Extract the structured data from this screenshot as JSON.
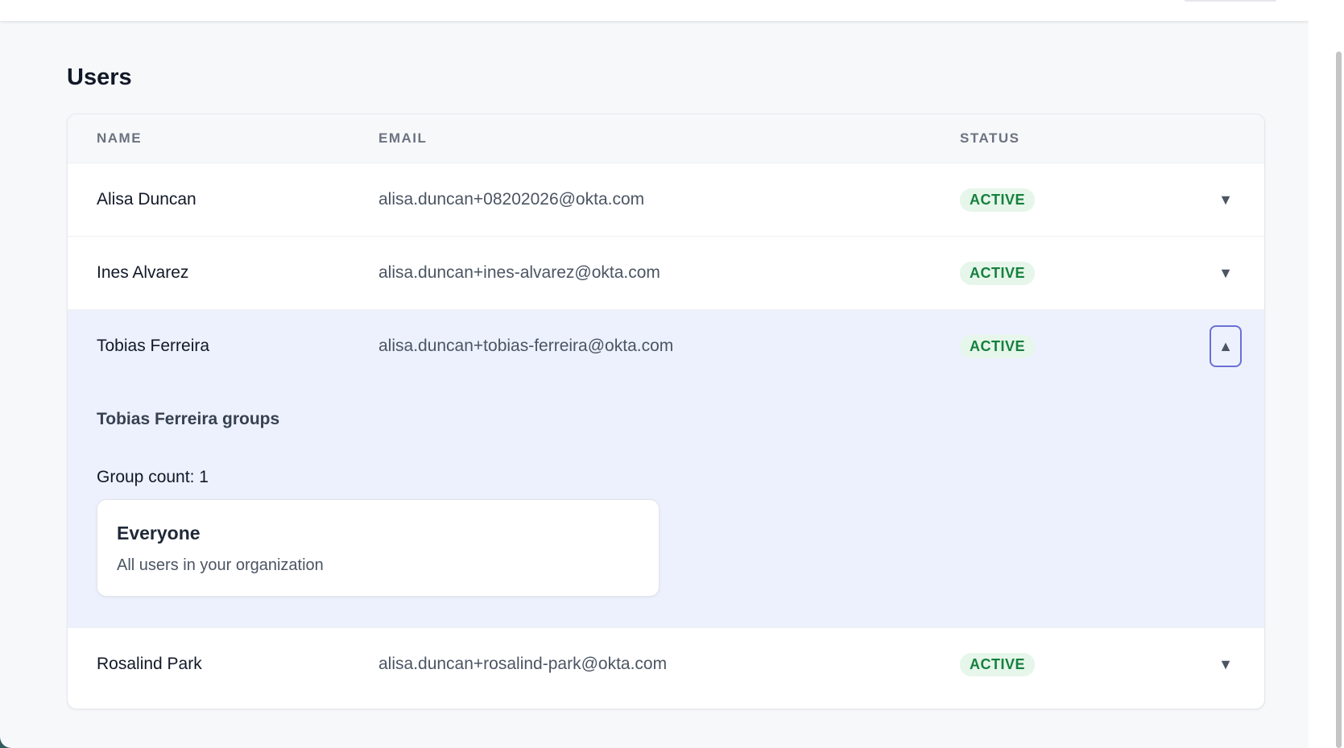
{
  "page": {
    "title": "Users"
  },
  "table": {
    "headers": {
      "name": "NAME",
      "email": "EMAIL",
      "status": "STATUS"
    },
    "rows": [
      {
        "name": "Alisa Duncan",
        "email": "alisa.duncan+08202026@okta.com",
        "status": "ACTIVE",
        "toggle": "▼"
      },
      {
        "name": "Ines Alvarez",
        "email": "alisa.duncan+ines-alvarez@okta.com",
        "status": "ACTIVE",
        "toggle": "▼"
      },
      {
        "name": "Tobias Ferreira",
        "email": "alisa.duncan+tobias-ferreira@okta.com",
        "status": "ACTIVE",
        "toggle": "▲"
      },
      {
        "name": "Rosalind Park",
        "email": "alisa.duncan+rosalind-park@okta.com",
        "status": "ACTIVE",
        "toggle": "▼"
      }
    ]
  },
  "expanded": {
    "groups_title": "Tobias Ferreira groups",
    "group_count": "Group count: 1",
    "groups": [
      {
        "name": "Everyone",
        "description": "All users in your organization"
      }
    ]
  },
  "colors": {
    "active_badge_bg": "#e6f6ea",
    "active_badge_text": "#15803d",
    "expanded_bg": "#edf1fd",
    "focus_ring": "#6b6fd6"
  }
}
